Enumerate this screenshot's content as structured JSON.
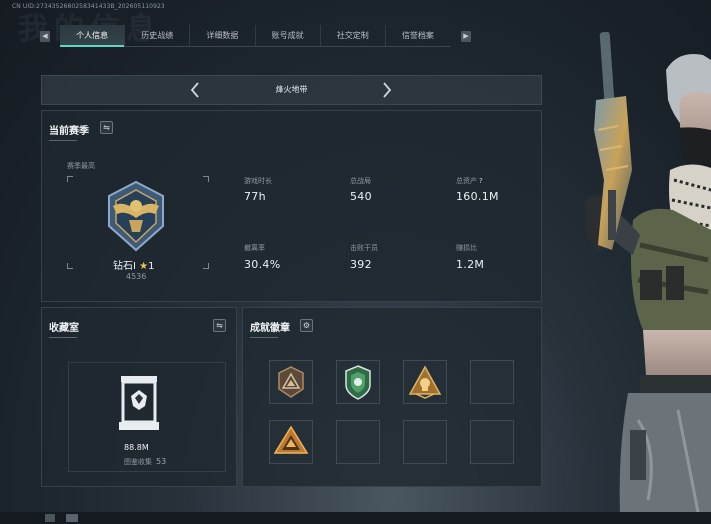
{
  "header": {
    "uid": "CN UID:2734352680258341433B_202605110923",
    "bg_title": "我的信息"
  },
  "tabs": [
    {
      "label": "个人信息",
      "active": true
    },
    {
      "label": "历史战绩",
      "active": false
    },
    {
      "label": "详细数据",
      "active": false
    },
    {
      "label": "账号成就",
      "active": false
    },
    {
      "label": "社交定制",
      "active": false
    },
    {
      "label": "信誉档案",
      "active": false
    }
  ],
  "mode": {
    "name": "烽火地带"
  },
  "season": {
    "title": "当前赛季",
    "best_label": "赛季最高",
    "rank_name": "钻石I",
    "rank_star": "★",
    "rank_level": "1",
    "rank_score": "4536",
    "stats": [
      {
        "label": "游戏时长",
        "value": "77h"
      },
      {
        "label": "总战局",
        "value": "540"
      },
      {
        "label": "总资产",
        "value": "160.1M",
        "help": "?"
      },
      {
        "label": "撤离率",
        "value": "30.4%"
      },
      {
        "label": "击败干员",
        "value": "392"
      },
      {
        "label": "赚损比",
        "value": "1.2M"
      }
    ]
  },
  "collection": {
    "title": "收藏室",
    "value": "88.8M",
    "label": "图鉴收集",
    "count": "53"
  },
  "badges": {
    "title": "成就徽章",
    "slots": [
      {
        "icon": "mountain-triangle-badge",
        "filled": true
      },
      {
        "icon": "green-shield-badge",
        "filled": true
      },
      {
        "icon": "gold-skull-triangle-badge",
        "filled": true
      },
      {
        "icon": "empty",
        "filled": false
      },
      {
        "icon": "orange-triangle-badge",
        "filled": true
      },
      {
        "icon": "empty",
        "filled": false
      },
      {
        "icon": "empty",
        "filled": false
      },
      {
        "icon": "empty",
        "filled": false
      }
    ]
  },
  "colors": {
    "accent": "#5fd7c1",
    "panel": "#1f2830",
    "gold": "#e8c45a"
  }
}
